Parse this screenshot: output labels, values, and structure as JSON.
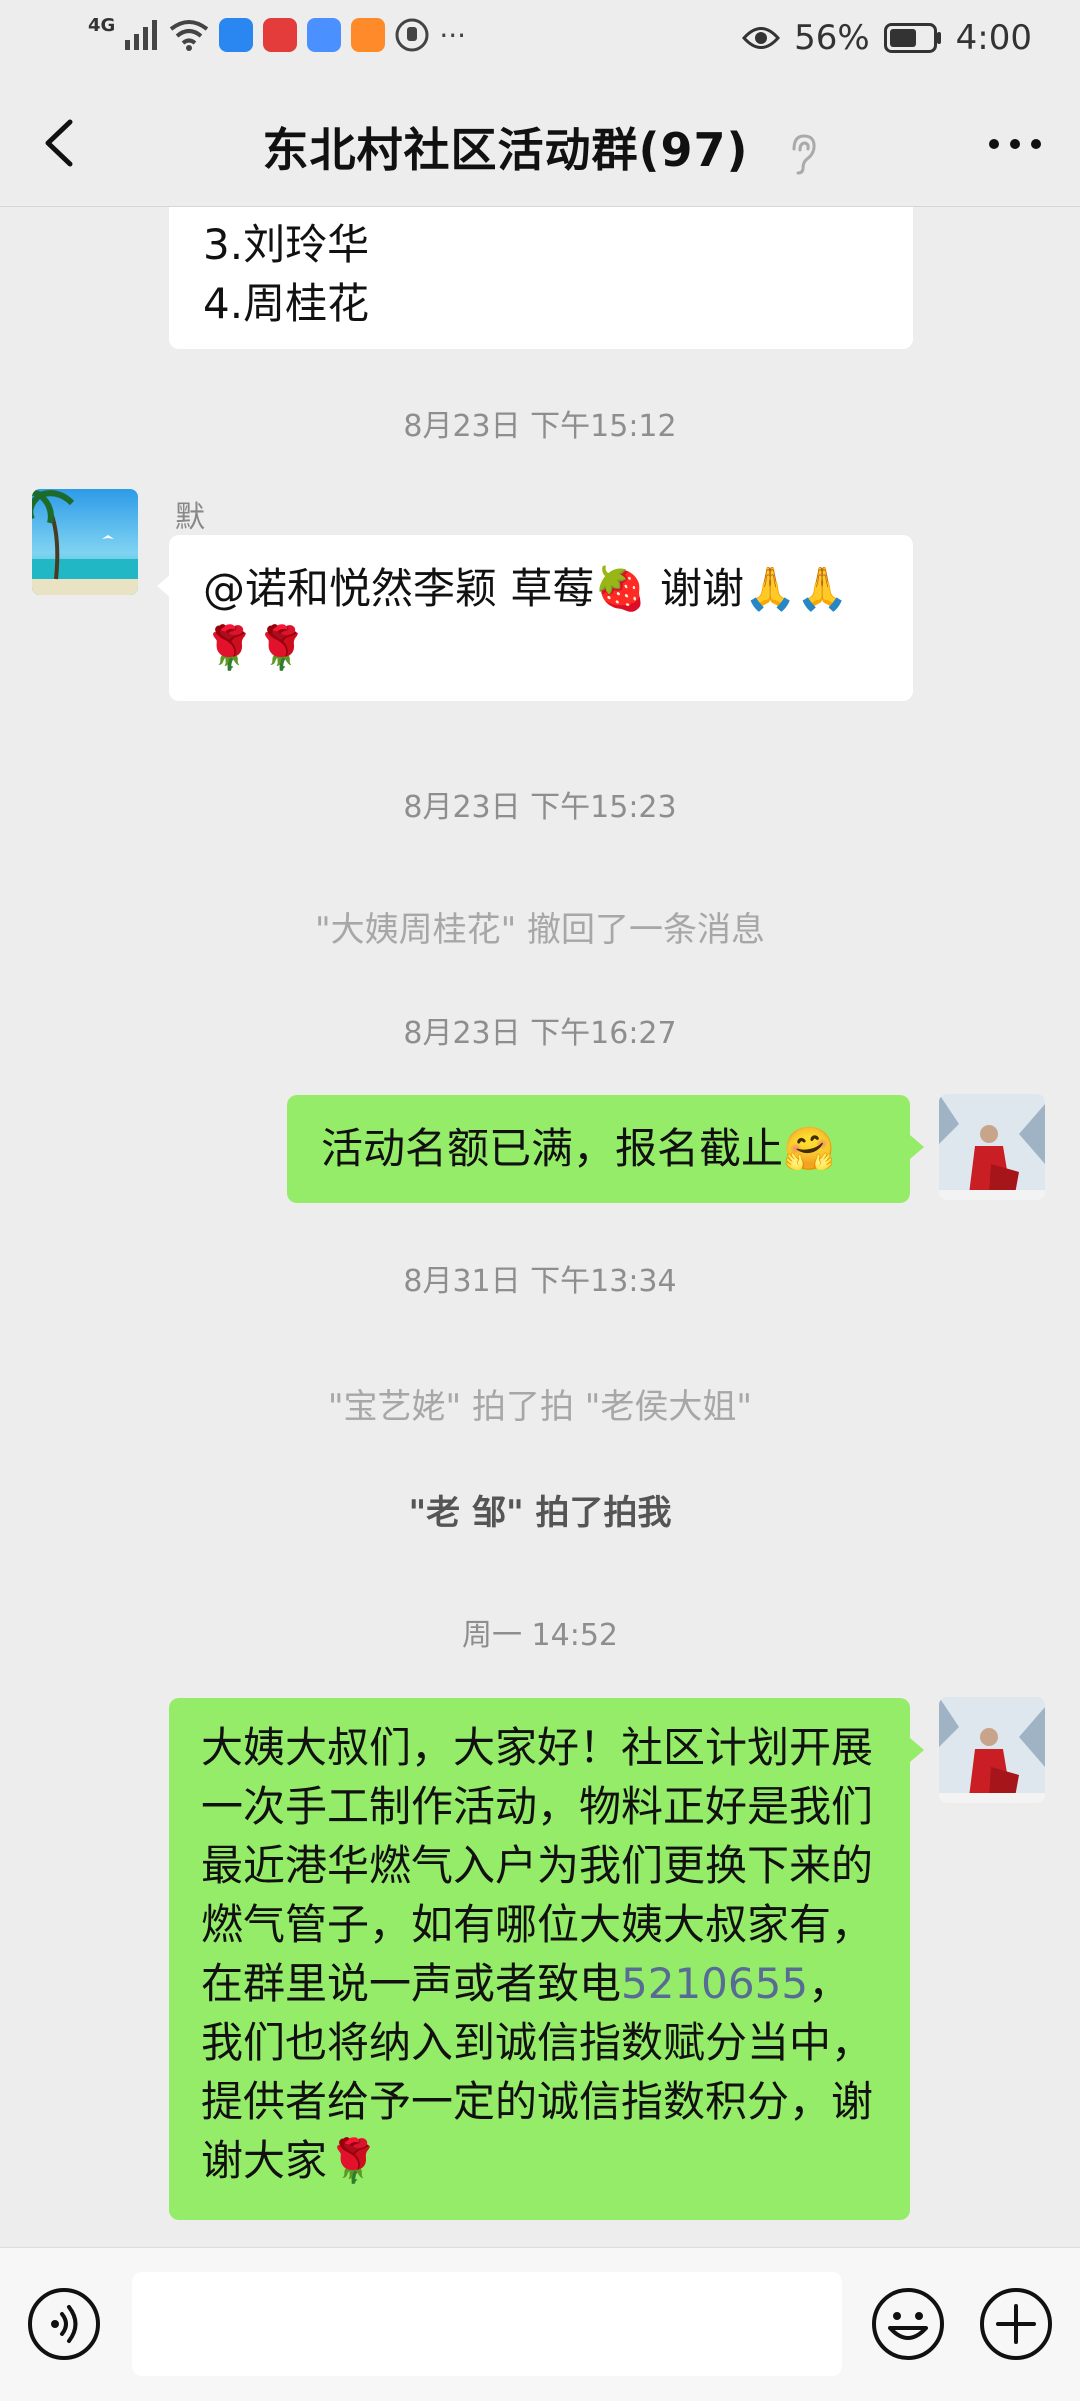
{
  "status_bar": {
    "signal_label": "4G",
    "battery_percent": "56%",
    "time": "4:00",
    "more": "···"
  },
  "header": {
    "title": "东北村社区活动群(97)"
  },
  "messages": {
    "top_list_line1": "3.刘玲华",
    "top_list_line2": "4.周桂花",
    "time1": "8月23日 下午15:12",
    "sender1": "默",
    "msg1_text": "@诺和悦然李颖  草莓🍓  谢谢🙏🙏🌹🌹",
    "time2": "8月23日 下午15:23",
    "recall_notice": "\"大姨周桂花\" 撤回了一条消息",
    "time3": "8月23日 下午16:27",
    "msg2_text": "活动名额已满，报名截止🤗",
    "time4": "8月31日 下午13:34",
    "pat1": "\"宝艺姥\" 拍了拍 \"老侯大姐\"",
    "pat2": "\"老 邹\" 拍了拍我",
    "time5": "周一 14:52",
    "msg3_before_phone": "大姨大叔们，大家好！社区计划开展一次手工制作活动，物料正好是我们最近港华燃气入户为我们更换下来的燃气管子，如有哪位大姨大叔家有，在群里说一声或者致电",
    "msg3_phone": "5210655",
    "msg3_after_phone": "，我们也将纳入到诚信指数赋分当中，提供者给予一定的诚信指数积分，谢谢大家🌹"
  },
  "icons": {
    "back": "chevron-left-icon",
    "ear": "ear-icon",
    "more": "more-icon",
    "voice": "voice-icon",
    "emoji": "emoji-icon",
    "add": "plus-icon"
  },
  "colors": {
    "background": "#ededed",
    "bubble_self": "#95ec69",
    "bubble_other": "#ffffff",
    "link": "#576b95"
  }
}
